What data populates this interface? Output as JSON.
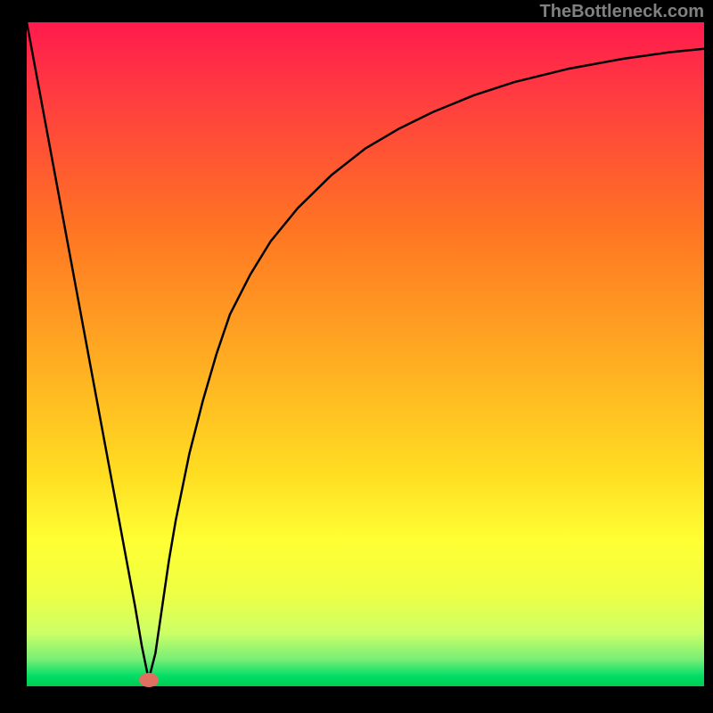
{
  "watermark": "TheBottleneck.com",
  "colors": {
    "curve": "#000000",
    "marker": "#e07060",
    "frame": "#000000"
  },
  "chart_data": {
    "type": "line",
    "title": "",
    "xlabel": "",
    "ylabel": "",
    "xlim": [
      0,
      100
    ],
    "ylim": [
      0,
      100
    ],
    "grid": false,
    "legend": false,
    "marker": {
      "x": 18,
      "y": 1
    },
    "series": [
      {
        "name": "bottleneck-curve",
        "x": [
          0,
          2,
          4,
          6,
          8,
          10,
          12,
          14,
          16,
          17,
          18,
          19,
          20,
          21,
          22,
          24,
          26,
          28,
          30,
          33,
          36,
          40,
          45,
          50,
          55,
          60,
          66,
          72,
          80,
          88,
          95,
          100
        ],
        "y": [
          100,
          89,
          78,
          67,
          56,
          45,
          34,
          23,
          12,
          6,
          1,
          5,
          12,
          19,
          25,
          35,
          43,
          50,
          56,
          62,
          67,
          72,
          77,
          81,
          84,
          86.5,
          89,
          91,
          93,
          94.5,
          95.5,
          96
        ]
      }
    ]
  }
}
